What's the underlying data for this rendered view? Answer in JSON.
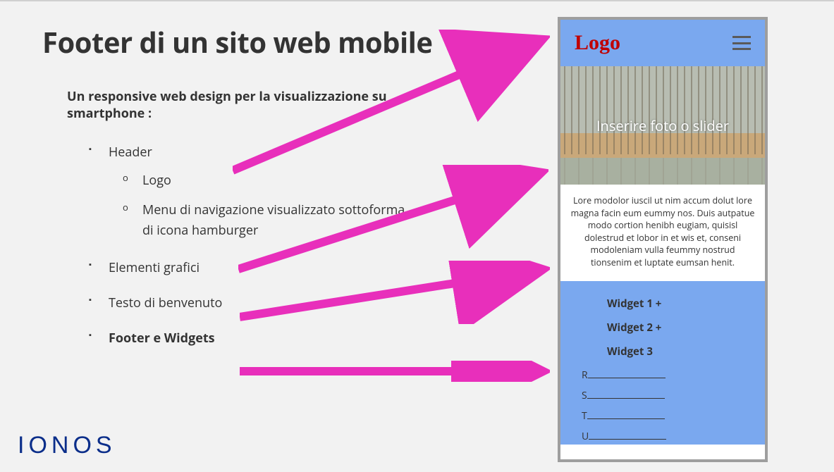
{
  "title": "Footer di un sito web mobile",
  "subtitle": "Un responsive web design per la visualizzazione su smartphone :",
  "list": {
    "header": "Header",
    "header_sub": {
      "logo": "Logo",
      "menu": "Menu di navigazione visualizzato sottoforma di icona hamburger"
    },
    "graphics": "Elementi grafici",
    "welcome": "Testo di benvenuto",
    "footer": "Footer e Widgets"
  },
  "brand": "IONOS",
  "phone": {
    "logo": "Logo",
    "slider_text": "Inserire foto o slider",
    "welcome_text": "Lore modolor iuscil ut nim accum dolut lore magna facin eum eummy nos. Duis autpatue modo cortion henibh eugiam, quisisl dolestrud et lobor in et wis et, conseni modoleniam vulla feummy nostrud tionsenim et luptate eumsan henit.",
    "widgets": {
      "w1": "Widget 1 +",
      "w2": "Widget 2 +",
      "w3": "Widget 3"
    },
    "links": {
      "r": "R",
      "s": "S",
      "t": "T",
      "u": "U"
    }
  }
}
